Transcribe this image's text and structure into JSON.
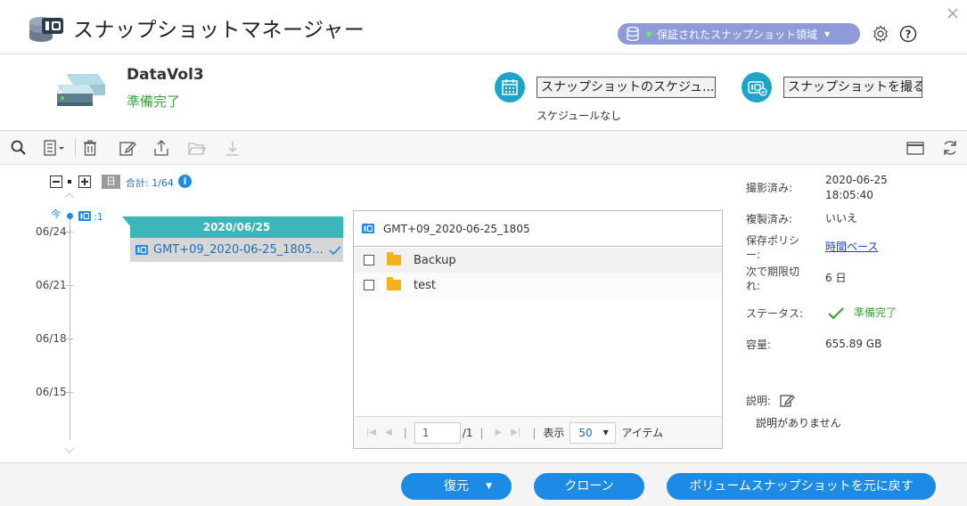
{
  "header": {
    "title": "スナップショットマネージャー",
    "region_label": "保証されたスナップショット領域",
    "region_dot_color": "#6fe07a"
  },
  "volume": {
    "name": "DataVol3",
    "status": "準備完了",
    "schedule_button": "スナップショットのスケジュ...",
    "schedule_status": "スケジュールなし",
    "take_button": "スナップショットを撮る"
  },
  "timeline": {
    "day_badge": "日",
    "total": "合計: 1/64",
    "now_label": "今",
    "now_count": ":1",
    "dates": [
      "06/24",
      "06/21",
      "06/18",
      "06/15"
    ]
  },
  "snapshot_group": {
    "date": "2020/06/25",
    "item": "GMT+09_2020-06-25_1805..."
  },
  "file_panel": {
    "title": "GMT+09_2020-06-25_1805",
    "files": [
      "Backup",
      "test"
    ],
    "pager": {
      "page": "1",
      "total_pages": "/1",
      "show_label": "表示",
      "per_page": "50",
      "items_label": "アイテム"
    }
  },
  "info": {
    "taken_label": "撮影済み:",
    "taken_value_date": "2020-06-25",
    "taken_value_time": "18:05:40",
    "replicated_label": "複製済み:",
    "replicated_value": "いいえ",
    "policy_label_1": "保存ポリシ",
    "policy_label_2": "ー:",
    "policy_value": "時間ベース",
    "expire_label_1": "次で期限切",
    "expire_label_2": "れ:",
    "expire_value": "6 日",
    "status_label": "ステータス:",
    "status_value": "準備完了",
    "capacity_label": "容量:",
    "capacity_value": "655.89 GB",
    "desc_label": "説明:",
    "desc_value": "説明がありません"
  },
  "footer": {
    "restore": "復元",
    "clone": "クローン",
    "revert": "ボリュームスナップショットを元に戻す"
  },
  "colors": {
    "accent": "#1c8be6",
    "teal": "#3cb5b9",
    "ready_green": "#3aa53a",
    "pill": "#8e9bd8"
  }
}
